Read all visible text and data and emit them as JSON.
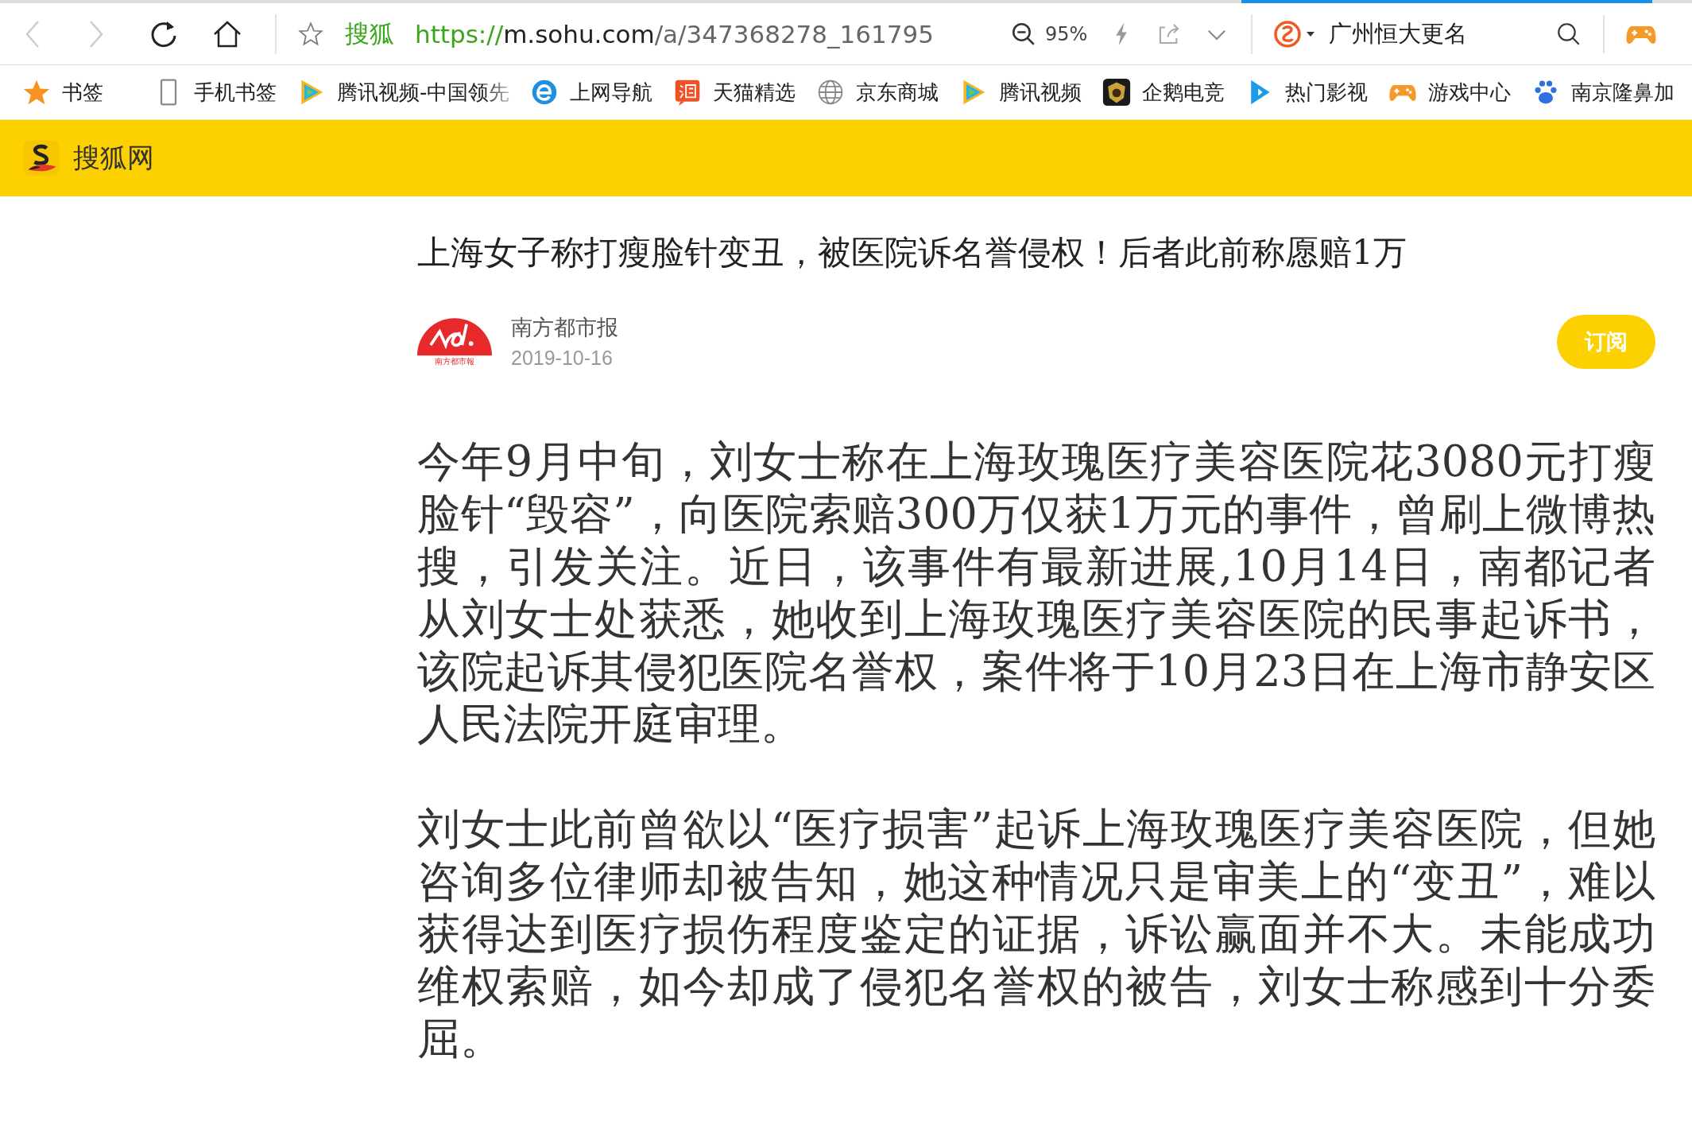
{
  "toolbar": {
    "back_disabled": true,
    "forward_disabled": true,
    "site_name": "搜狐",
    "url": {
      "scheme": "https://",
      "host": "m.sohu.com",
      "path": "/a/347368278_161795"
    },
    "zoom": "95%",
    "search": {
      "value": "广州恒大更名"
    }
  },
  "bookmarks": [
    {
      "label": "书签",
      "kind": "star",
      "faded": false
    },
    {
      "label": "手机书签",
      "kind": "phone",
      "faded": false
    },
    {
      "label": "腾讯视频-中国领先",
      "kind": "play",
      "faded": true
    },
    {
      "label": "上网导航",
      "kind": "browser",
      "faded": false
    },
    {
      "label": "天猫精选",
      "kind": "shop",
      "faded": false
    },
    {
      "label": "京东商城",
      "kind": "globe",
      "faded": false
    },
    {
      "label": "腾讯视频",
      "kind": "play",
      "faded": false
    },
    {
      "label": "企鹅电竞",
      "kind": "emblem",
      "faded": false
    },
    {
      "label": "热门影视",
      "kind": "video",
      "faded": false
    },
    {
      "label": "游戏中心",
      "kind": "game",
      "faded": false
    },
    {
      "label": "南京隆鼻加",
      "kind": "paw",
      "faded": false
    }
  ],
  "site_header": {
    "title": "搜狐网"
  },
  "article": {
    "title": "上海女子称打瘦脸针变丑，被医院诉名誉侵权！后者此前称愿赔1万",
    "author": {
      "name": "南方都市报",
      "logo_caption": "南方都市報",
      "date": "2019-10-16"
    },
    "subscribe_button": "订阅",
    "paragraphs": [
      "今年9月中旬，刘女士称在上海玫瑰医疗美容医院花3080元打瘦脸针“毁容”，向医院索赔300万仅获1万元的事件，曾刷上微博热搜，引发关注。近日，该事件有最新进展,10月14日，南都记者从刘女士处获悉，她收到上海玫瑰医疗美容医院的民事起诉书，该院起诉其侵犯医院名誉权，案件将于10月23日在上海市静安区人民法院开庭审理。",
      "刘女士此前曾欲以“医疗损害”起诉上海玫瑰医疗美容医院，但她咨询多位律师却被告知，她这种情况只是审美上的“变丑”，难以获得达到医疗损伤程度鉴定的证据，诉讼赢面并不大。未能成功维权索赔，如今却成了侵犯名誉权的被告，刘女士称感到十分委屈。"
    ]
  }
}
